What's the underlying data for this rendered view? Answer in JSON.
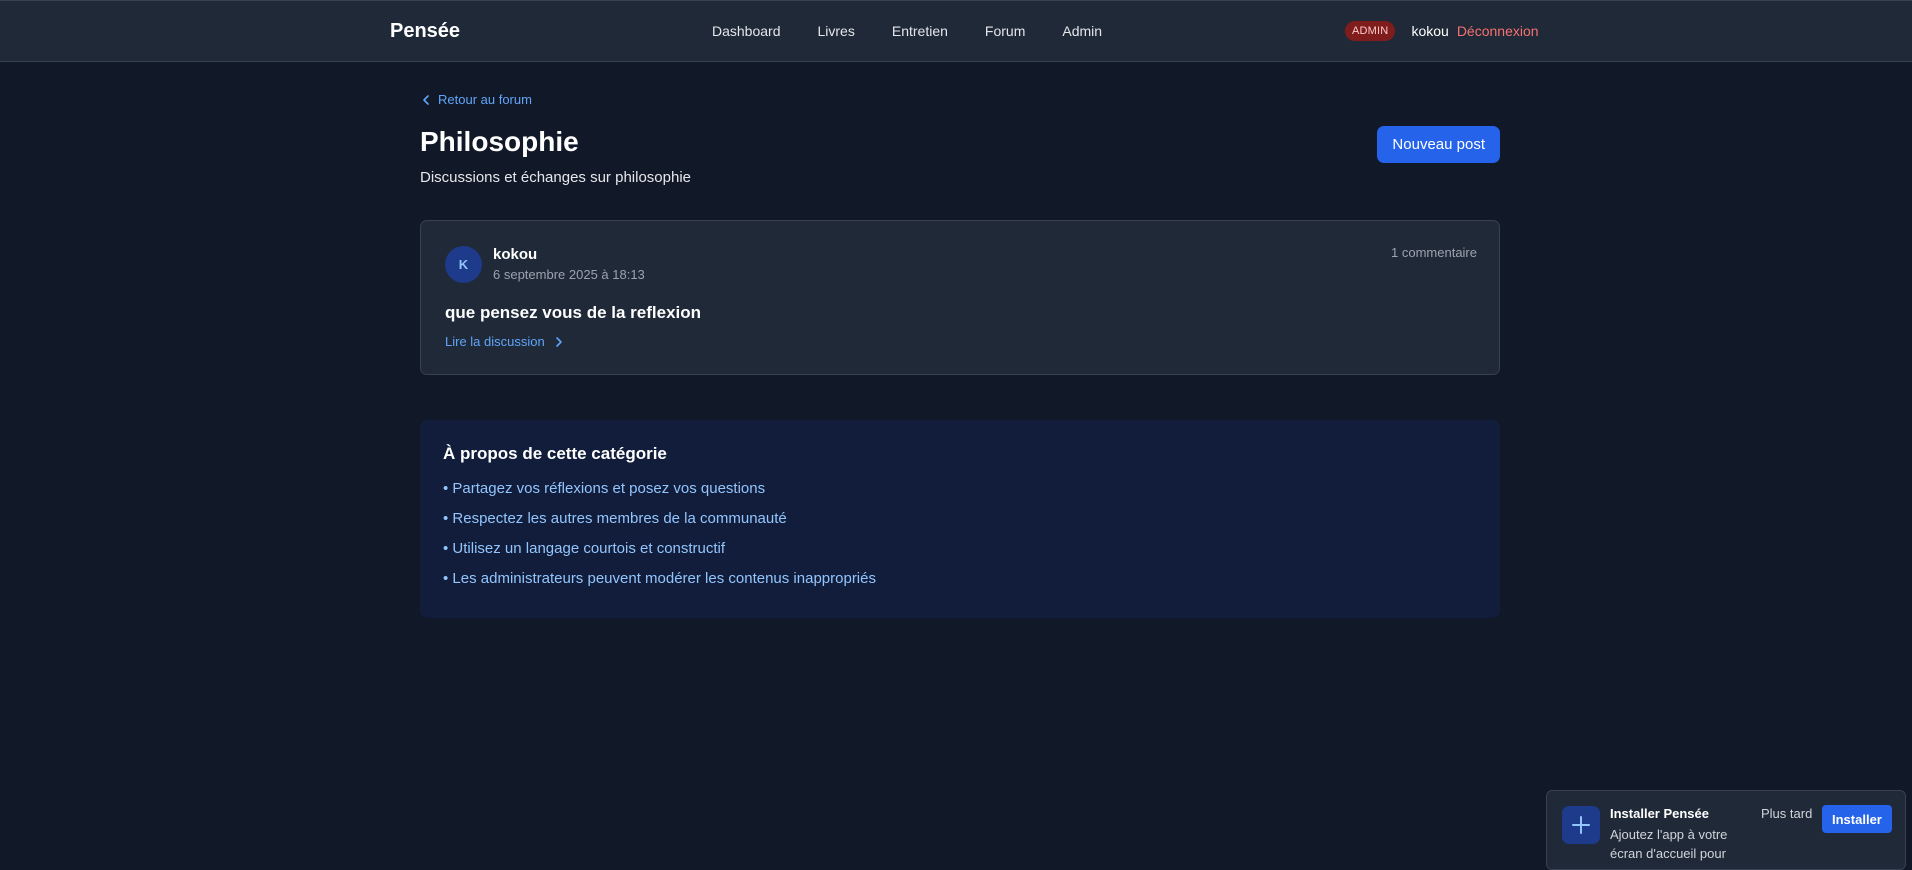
{
  "header": {
    "brand": "Pensée",
    "nav": [
      "Dashboard",
      "Livres",
      "Entretien",
      "Forum",
      "Admin"
    ],
    "badge": "ADMIN",
    "username": "kokou",
    "logout": "Déconnexion"
  },
  "page": {
    "back_link": "Retour au forum",
    "title": "Philosophie",
    "subtitle": "Discussions et échanges sur philosophie",
    "new_post_label": "Nouveau post"
  },
  "post": {
    "avatar_initial": "K",
    "author": "kokou",
    "date": "6 septembre 2025 à 18:13",
    "comments": "1 commentaire",
    "title": "que pensez vous de la reflexion",
    "read_link": "Lire la discussion"
  },
  "about": {
    "title": "À propos de cette catégorie",
    "rules": [
      "• Partagez vos réflexions et posez vos questions",
      "• Respectez les autres membres de la communauté",
      "• Utilisez un langage courtois et constructif",
      "• Les administrateurs peuvent modérer les contenus inappropriés"
    ]
  },
  "install": {
    "title": "Installer Pensée",
    "description": "Ajoutez l'app à votre écran d'accueil pour",
    "later_label": "Plus tard",
    "install_label": "Installer"
  },
  "icons": {
    "back": "chevron-left-icon",
    "read": "chevron-right-icon",
    "install": "plus-icon"
  },
  "colors": {
    "background": "#111827",
    "accent": "#2563eb",
    "link": "#60a5fa",
    "danger": "#f87171"
  }
}
